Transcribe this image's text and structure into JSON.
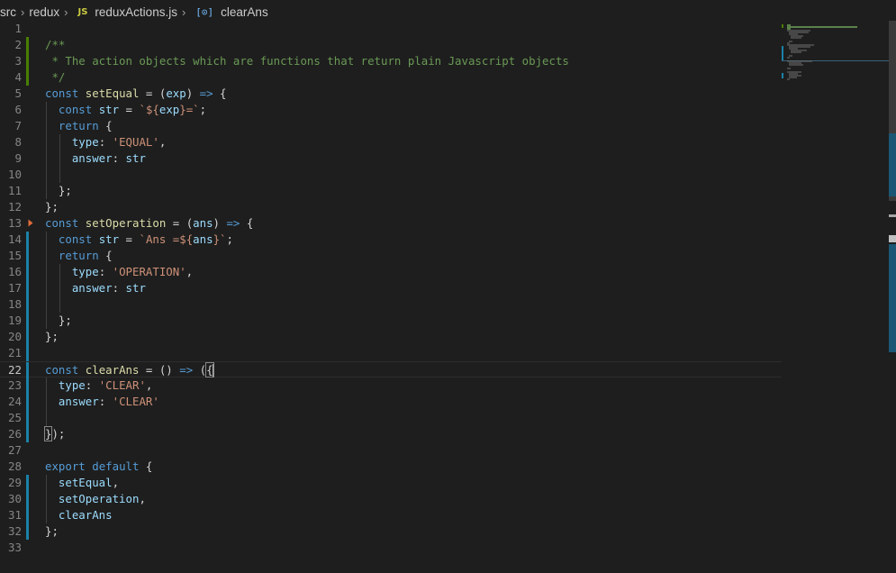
{
  "breadcrumb": {
    "segments": [
      "src",
      "redux",
      "reduxActions.js",
      "clearAns"
    ],
    "file_icon": "JS",
    "symbol_icon": "[⊙]"
  },
  "editor": {
    "lines": [
      {
        "no": "1"
      },
      {
        "no": "2"
      },
      {
        "no": "3"
      },
      {
        "no": "4"
      },
      {
        "no": "5"
      },
      {
        "no": "6"
      },
      {
        "no": "7"
      },
      {
        "no": "8"
      },
      {
        "no": "9"
      },
      {
        "no": "10"
      },
      {
        "no": "11"
      },
      {
        "no": "12"
      },
      {
        "no": "13"
      },
      {
        "no": "14"
      },
      {
        "no": "15"
      },
      {
        "no": "16"
      },
      {
        "no": "17"
      },
      {
        "no": "18"
      },
      {
        "no": "19"
      },
      {
        "no": "20"
      },
      {
        "no": "21"
      },
      {
        "no": "22"
      },
      {
        "no": "23"
      },
      {
        "no": "24"
      },
      {
        "no": "25"
      },
      {
        "no": "26"
      },
      {
        "no": "27"
      },
      {
        "no": "28"
      },
      {
        "no": "29"
      },
      {
        "no": "30"
      },
      {
        "no": "31"
      },
      {
        "no": "32"
      },
      {
        "no": "33"
      }
    ],
    "tokens": {
      "l2_c": "/**",
      "l3_c": " * The action objects which are functions that return plain Javascript objects",
      "l4_c": " */",
      "const": "const",
      "return": "return",
      "export": "export",
      "default": "default",
      "setEqual": "setEqual",
      "setOperation": "setOperation",
      "clearAns": "clearAns",
      "exp": "exp",
      "ans": "ans",
      "str": "str",
      "type": "type",
      "answer": "answer",
      "s_tpl1_a": "`${",
      "s_tpl1_b": "}=`",
      "s_tpl2_a": "`Ans =${",
      "s_tpl2_b": "}`",
      "s_equal": "'EQUAL'",
      "s_operation": "'OPERATION'",
      "s_clear": "'CLEAR'",
      "arrow": "=>"
    },
    "colors": {
      "background": "#1e1e1e",
      "keyword": "#569cd6",
      "comment": "#6a9955",
      "function": "#dcdcaa",
      "variable": "#9cdcfe",
      "string": "#ce9178",
      "modified_gutter": "#1b81a8",
      "added_gutter": "#487e02"
    }
  }
}
